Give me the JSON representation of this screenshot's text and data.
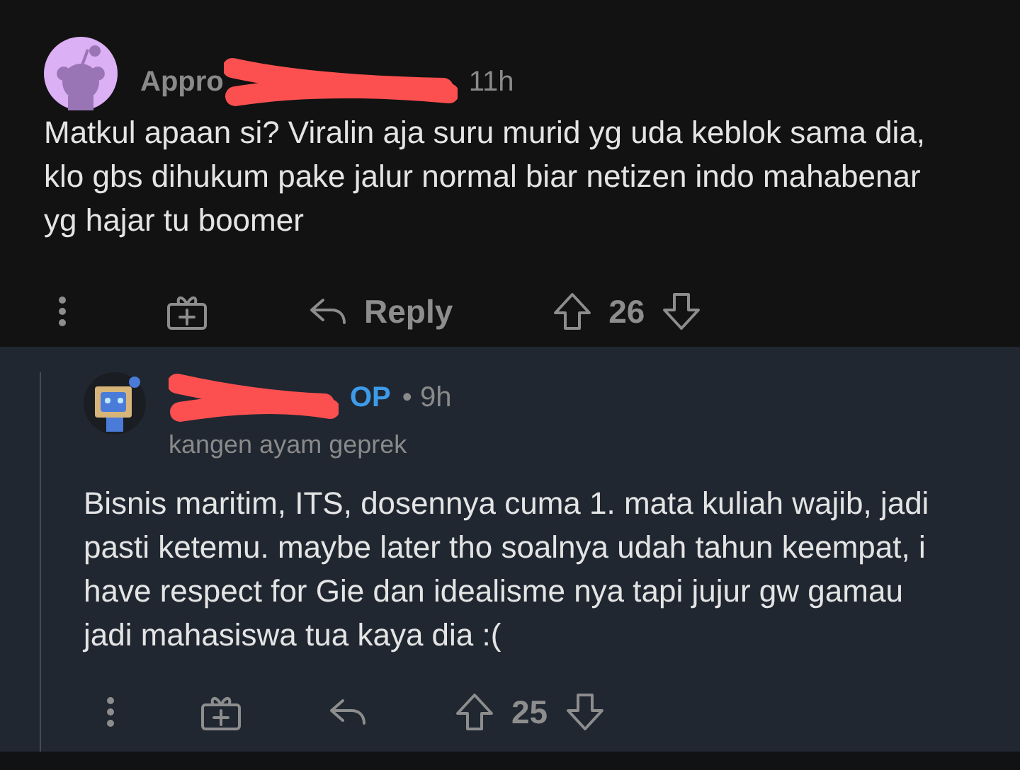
{
  "comments": [
    {
      "avatar": {
        "kind": "snoo"
      },
      "username": "Appro",
      "redacted": true,
      "time": "11h",
      "body": "Matkul apaan si? Viralin aja suru murid yg uda keblok sama dia, klo gbs dihukum pake jalur normal biar netizen indo mahabenar yg hajar tu boomer",
      "reply_label": "Reply",
      "votes": "26",
      "nested": false
    },
    {
      "avatar": {
        "kind": "robot"
      },
      "op_label": "OP",
      "redacted": true,
      "time": "• 9h",
      "flair": "kangen ayam geprek",
      "body": "Bisnis maritim, ITS, dosennya cuma 1. mata kuliah wajib, jadi pasti ketemu. maybe later tho soalnya udah tahun keempat, i have respect for Gie dan idealisme nya tapi jujur gw gamau jadi mahasiswa tua kaya dia :(",
      "votes": "25",
      "nested": true
    }
  ]
}
